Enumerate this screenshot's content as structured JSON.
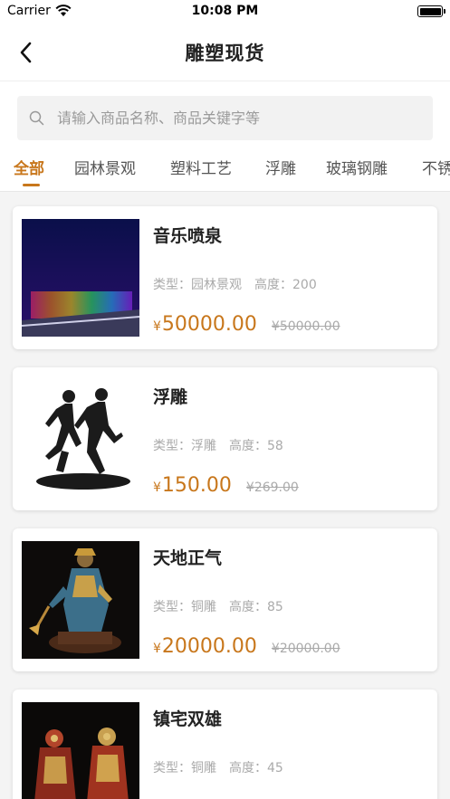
{
  "status": {
    "carrier": "Carrier",
    "time": "10:08 PM"
  },
  "nav": {
    "title": "雕塑现货"
  },
  "search": {
    "placeholder": "请输入商品名称、商品关键字等"
  },
  "tabs": [
    {
      "label": "全部",
      "active": true
    },
    {
      "label": "园林景观"
    },
    {
      "label": "塑料工艺"
    },
    {
      "label": "浮雕"
    },
    {
      "label": "玻璃钢雕"
    },
    {
      "label": "不锈"
    }
  ],
  "products": [
    {
      "name": "音乐喷泉",
      "type_label": "类型：",
      "type": "园林景观",
      "height_label": "高度：",
      "height": "200",
      "currency": "¥",
      "price": "50000.00",
      "old_price": "¥50000.00"
    },
    {
      "name": "浮雕",
      "type_label": "类型：",
      "type": "浮雕",
      "height_label": "高度：",
      "height": "58",
      "currency": "¥",
      "price": "150.00",
      "old_price": "¥269.00"
    },
    {
      "name": "天地正气",
      "type_label": "类型：",
      "type": "铜雕",
      "height_label": "高度：",
      "height": "85",
      "currency": "¥",
      "price": "20000.00",
      "old_price": "¥20000.00"
    },
    {
      "name": "镇宅双雄",
      "type_label": "类型：",
      "type": "铜雕",
      "height_label": "高度：",
      "height": "45",
      "currency": "",
      "price": "",
      "old_price": ""
    }
  ],
  "colors": {
    "accent": "#c8771c",
    "background": "#f4f4f4",
    "muted": "#aaaaaa"
  }
}
